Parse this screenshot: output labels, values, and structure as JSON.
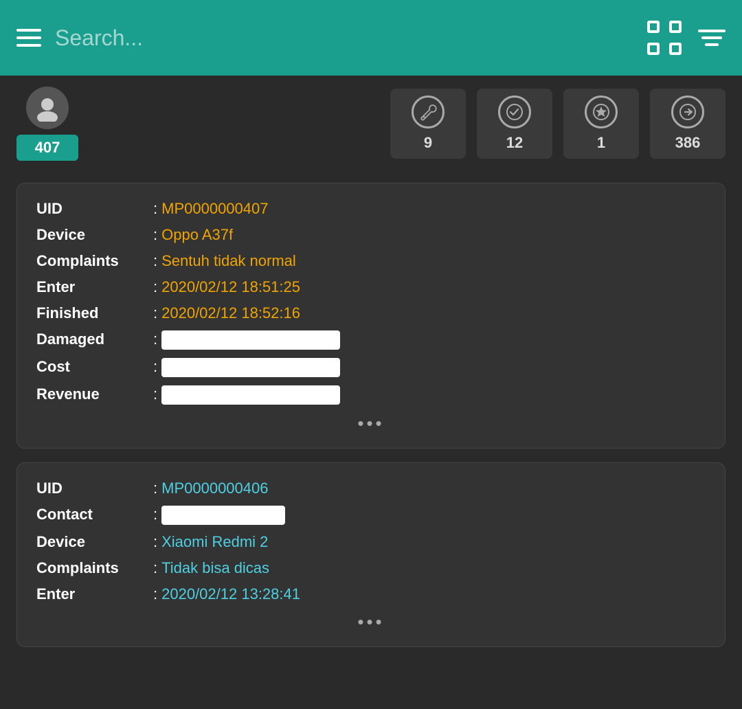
{
  "topbar": {
    "search_placeholder": "Search...",
    "hamburger_label": "Menu",
    "scan_label": "Scan",
    "filter_label": "Filter"
  },
  "stats": {
    "avatar_label": "User Avatar",
    "total_count": "407",
    "stat_items": [
      {
        "icon": "wrench",
        "count": "9",
        "label": "In Progress"
      },
      {
        "icon": "checkmark",
        "count": "12",
        "label": "Done"
      },
      {
        "icon": "star",
        "count": "1",
        "label": "Starred"
      },
      {
        "icon": "arrow",
        "count": "386",
        "label": "Forwarded"
      }
    ]
  },
  "cards": [
    {
      "uid_label": "UID",
      "uid_value": "MP0000000407",
      "device_label": "Device",
      "device_value": "Oppo A37f",
      "complaints_label": "Complaints",
      "complaints_value": "Sentuh tidak normal",
      "enter_label": "Enter",
      "enter_value": "2020/02/12 18:51:25",
      "finished_label": "Finished",
      "finished_value": "2020/02/12 18:52:16",
      "damaged_label": "Damaged",
      "cost_label": "Cost",
      "revenue_label": "Revenue",
      "more": "•••"
    },
    {
      "uid_label": "UID",
      "uid_value": "MP0000000406",
      "contact_label": "Contact",
      "device_label": "Device",
      "device_value": "Xiaomi Redmi 2",
      "complaints_label": "Complaints",
      "complaints_value": "Tidak bisa dicas",
      "enter_label": "Enter",
      "enter_value": "2020/02/12 13:28:41",
      "more": "•••"
    }
  ],
  "colors": {
    "teal": "#1a9e8e",
    "orange": "#f0a500",
    "cyan": "#4dd0e1",
    "bg_dark": "#2a2a2a",
    "card_bg": "#333333"
  }
}
